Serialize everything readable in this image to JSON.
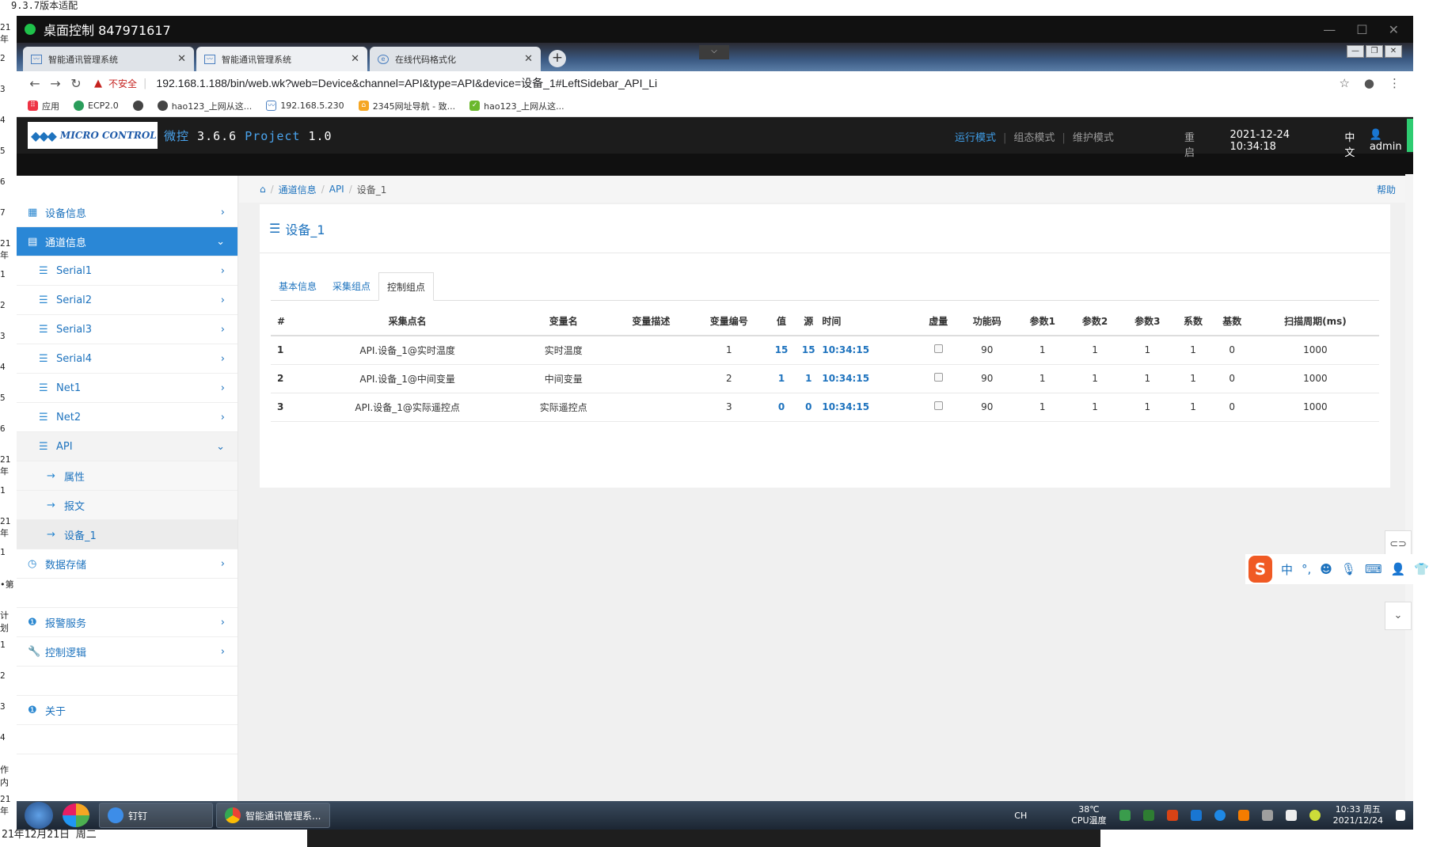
{
  "host": {
    "top_text": "9.3.7版本适配",
    "left_fragments": [
      "21年",
      "2",
      "3",
      "4",
      "5",
      "6",
      "7",
      "21年",
      "1",
      "2",
      "3",
      "4",
      "5",
      "6",
      "21年",
      "1",
      "21年",
      "1",
      "•第",
      "计划",
      "1",
      "2",
      "3",
      "4",
      "作内",
      "21年"
    ],
    "bottom_text": "21年12月21日 周二"
  },
  "remote": {
    "title": "桌面控制 847971617",
    "controls": [
      "—",
      "☐",
      "✕"
    ]
  },
  "browser": {
    "tabs": [
      {
        "title": "智能通讯管理系统",
        "active": false
      },
      {
        "title": "智能通讯管理系统",
        "active": true
      },
      {
        "title": "在线代码格式化",
        "active": false
      }
    ],
    "insecure_label": "不安全",
    "url": "192.168.1.188/bin/web.wk?web=Device&channel=API&type=API&device=设备_1#LeftSidebar_API_Li",
    "bookmarks": [
      "应用",
      "ECP2.0",
      "",
      "hao123_上网从这...",
      "192.168.5.230",
      "2345网址导航 - 致...",
      "hao123_上网从这..."
    ]
  },
  "header": {
    "logo_text": "MICRO CONTROL",
    "product_prefix": "微控",
    "product_version": "3.6.6",
    "project_label": "Project",
    "project_version": "1.0",
    "modes": [
      "运行模式",
      "组态模式",
      "维护模式"
    ],
    "restart": "重启",
    "datetime": "2021-12-24 10:34:18",
    "language": "中文",
    "user": "admin"
  },
  "sidebar": {
    "device_info": "设备信息",
    "channel_info": "通道信息",
    "serial1": "Serial1",
    "serial2": "Serial2",
    "serial3": "Serial3",
    "serial4": "Serial4",
    "net1": "Net1",
    "net2": "Net2",
    "api": "API",
    "attributes": "属性",
    "message": "报文",
    "device1": "设备_1",
    "data_storage": "数据存储",
    "alarm_service": "报警服务",
    "control_logic": "控制逻辑",
    "about": "关于"
  },
  "breadcrumb": {
    "items": [
      "通道信息",
      "API",
      "设备_1"
    ],
    "help": "帮助"
  },
  "page": {
    "title": "设备_1",
    "tabs": [
      "基本信息",
      "采集组点",
      "控制组点"
    ],
    "active_tab": "控制组点"
  },
  "table": {
    "headers": [
      "#",
      "采集点名",
      "变量名",
      "变量描述",
      "变量编号",
      "值",
      "源",
      "时间",
      "虚量",
      "功能码",
      "参数1",
      "参数2",
      "参数3",
      "系数",
      "基数",
      "扫描周期(ms)"
    ],
    "rows": [
      [
        "1",
        "API.设备_1@实时温度",
        "实时温度",
        "",
        "1",
        "15",
        "15",
        "10:34:15",
        "",
        "90",
        "1",
        "1",
        "1",
        "1",
        "0",
        "1000"
      ],
      [
        "2",
        "API.设备_1@中间变量",
        "中间变量",
        "",
        "2",
        "1",
        "1",
        "10:34:15",
        "",
        "90",
        "1",
        "1",
        "1",
        "1",
        "0",
        "1000"
      ],
      [
        "3",
        "API.设备_1@实际遥控点",
        "实际遥控点",
        "",
        "3",
        "0",
        "0",
        "10:34:15",
        "",
        "90",
        "1",
        "1",
        "1",
        "1",
        "0",
        "1000"
      ]
    ]
  },
  "ime": {
    "logo": "S",
    "items": [
      "中",
      "°,"
    ]
  },
  "taskbar": {
    "apps": [
      "钉钉",
      "智能通讯管理系..."
    ],
    "lang": "CH",
    "temp": "38℃",
    "temp_label": "CPU温度",
    "time": "10:33 周五",
    "date": "2021/12/24"
  },
  "colors": {
    "accent": "#1e73be",
    "active_nav": "#2a87d6",
    "header_bg": "#1c1c1c"
  }
}
